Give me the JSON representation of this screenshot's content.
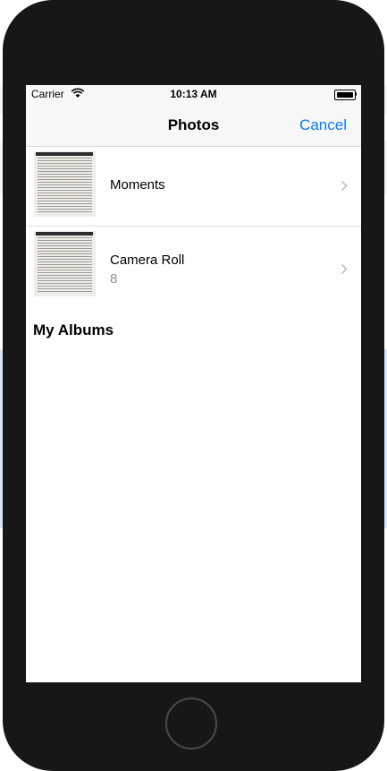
{
  "status_bar": {
    "carrier": "Carrier",
    "time": "10:13 AM"
  },
  "nav": {
    "title": "Photos",
    "cancel_label": "Cancel"
  },
  "albums": [
    {
      "title": "Moments",
      "count": ""
    },
    {
      "title": "Camera Roll",
      "count": "8"
    }
  ],
  "section": {
    "my_albums": "My Albums"
  },
  "colors": {
    "accent": "#0a7aff",
    "device": "#171717",
    "secondary_text": "#8e8e93"
  }
}
